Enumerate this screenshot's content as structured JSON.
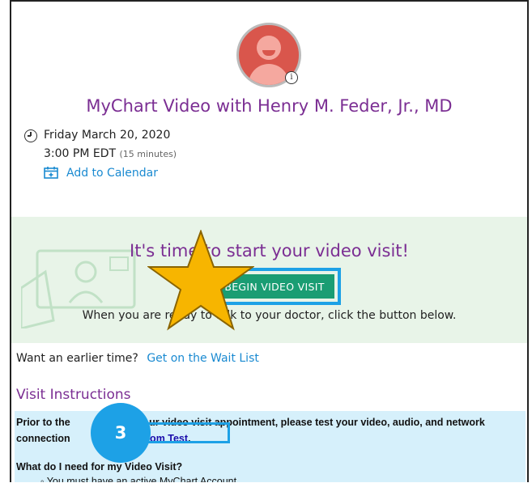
{
  "header": {
    "title": "MyChart Video with Henry M. Feder, Jr., MD"
  },
  "appointment": {
    "date": "Friday March 20, 2020",
    "time": "3:00 PM EDT",
    "duration": "(15 minutes)",
    "add_to_calendar": "Add to Calendar"
  },
  "video_visit": {
    "heading": "It's time to start your video visit!",
    "button_label": "BEGIN VIDEO VISIT",
    "subtext": "When you are ready to talk to your doctor, click the button below."
  },
  "waitlist": {
    "prompt": "Want an earlier time?",
    "link": "Get on the Wait List"
  },
  "instructions": {
    "title": "Visit Instructions",
    "p1_part1": "Prior to the ",
    "p1_part2": "ur video visit appointment, please test your video, audio, and network connection",
    "p1_part3": "o ",
    "zoom_link": "Zoom Test",
    "p1_part4": ".",
    "question": "What do I need for my Video Visit?",
    "bullet": "You must have an active MyChart Account"
  },
  "annotations": {
    "step_number": "3"
  },
  "colors": {
    "accent_purple": "#7b2e93",
    "link_blue": "#1a8ad1",
    "button_green": "#1a9d73",
    "highlight_blue": "#1da1e6",
    "star_gold": "#f7b500"
  }
}
